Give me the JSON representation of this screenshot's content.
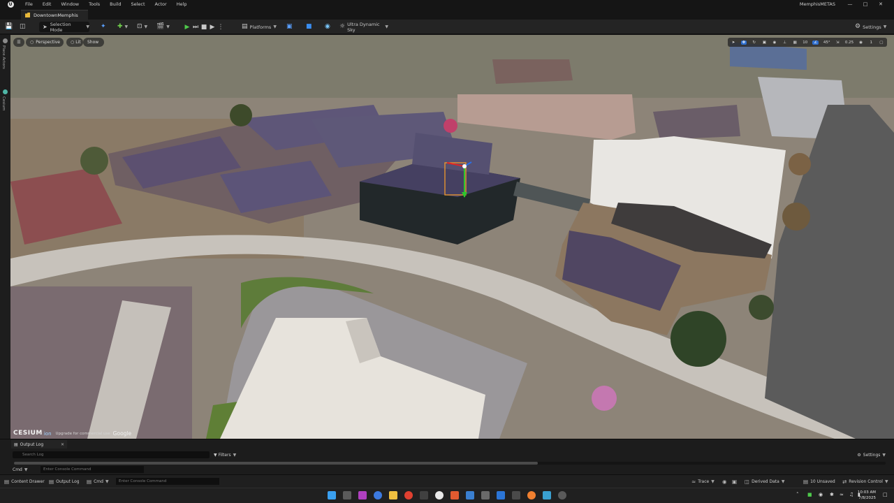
{
  "menubar": {
    "items": [
      "File",
      "Edit",
      "Window",
      "Tools",
      "Build",
      "Select",
      "Actor",
      "Help"
    ],
    "project_name": "MemphisMETAS"
  },
  "tab": {
    "level_name": "DowntownMemphis"
  },
  "toolbar": {
    "selection_mode": "Selection Mode",
    "platforms": "Platforms",
    "sky": "Ultra Dynamic Sky",
    "settings": "Settings"
  },
  "left_strip": {
    "place_actors": "Place Actors",
    "cesium": "Cesium"
  },
  "viewport": {
    "perspective": "Perspective",
    "lit": "Lit",
    "show": "Show",
    "grid_snap": "10",
    "rotation_snap": "45°",
    "scale_snap": "0.25",
    "camera_speed": "1",
    "cesium": {
      "brand": "CESIUM",
      "ion": "ion",
      "note": "Upgrade for commercial use",
      "google": "Google"
    }
  },
  "output_log": {
    "tab": "Output Log",
    "search_placeholder": "Search Log",
    "filters": "Filters",
    "settings": "Settings",
    "cmd": "Cmd",
    "console_placeholder": "Enter Console Command"
  },
  "statusbar": {
    "content_drawer": "Content Drawer",
    "output_log": "Output Log",
    "cmd": "Cmd",
    "console_placeholder": "Enter Console Command",
    "trace": "Trace",
    "derived_data": "Derived Data",
    "unsaved": "10 Unsaved",
    "revision_control": "Revision Control"
  },
  "taskbar": {
    "time": "10:03 AM",
    "date": "7/8/2025"
  }
}
